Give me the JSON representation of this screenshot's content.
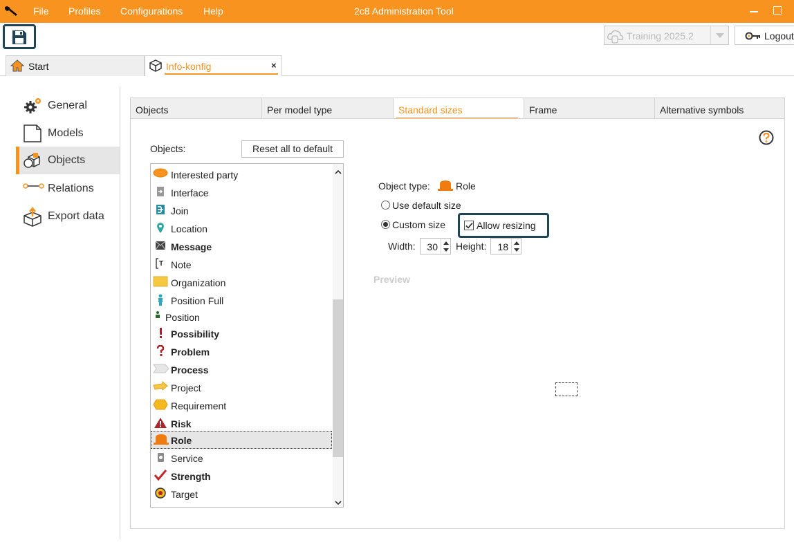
{
  "titlebar": {
    "menu": [
      "File",
      "Profiles",
      "Configurations",
      "Help"
    ],
    "title": "2c8 Administration Tool"
  },
  "toolbar": {
    "repository": "Training 2025.2",
    "logout": "Logout"
  },
  "page_tabs": [
    {
      "label": "Start",
      "icon": "home-icon"
    },
    {
      "label": "Info-konfig",
      "icon": "cube-icon",
      "close": "×"
    }
  ],
  "nav": [
    {
      "label": "General",
      "icon": "gears-icon"
    },
    {
      "label": "Models",
      "icon": "page-icon"
    },
    {
      "label": "Objects",
      "icon": "objects-icon",
      "active": true
    },
    {
      "label": "Relations",
      "icon": "relation-icon"
    },
    {
      "label": "Export data",
      "icon": "export-box-icon"
    }
  ],
  "inner_tabs": [
    "Objects",
    "Per model type",
    "Standard sizes",
    "Frame",
    "Alternative symbols"
  ],
  "standard_sizes": {
    "objects_label": "Objects:",
    "reset_label": "Reset all to default",
    "list": [
      {
        "label": "Interested party",
        "bold": false,
        "icon": "ellipse-icon"
      },
      {
        "label": "Interface",
        "bold": false,
        "icon": "interface-icon"
      },
      {
        "label": "Join",
        "bold": false,
        "icon": "join-icon"
      },
      {
        "label": "Location",
        "bold": false,
        "icon": "location-pin-icon"
      },
      {
        "label": "Message",
        "bold": true,
        "icon": "envelope-icon"
      },
      {
        "label": "Note",
        "bold": false,
        "icon": "note-icon"
      },
      {
        "label": "Organization",
        "bold": false,
        "icon": "organization-icon"
      },
      {
        "label": "Position Full",
        "bold": false,
        "icon": "person-icon"
      },
      {
        "label": "Position",
        "bold": false,
        "icon": "person-small-icon"
      },
      {
        "label": "Possibility",
        "bold": true,
        "icon": "exclamation-icon"
      },
      {
        "label": "Problem",
        "bold": true,
        "icon": "question-icon"
      },
      {
        "label": "Process",
        "bold": true,
        "icon": "process-arrow-icon"
      },
      {
        "label": "Project",
        "bold": false,
        "icon": "project-arrow-icon"
      },
      {
        "label": "Requirement",
        "bold": false,
        "icon": "hexagon-icon"
      },
      {
        "label": "Risk",
        "bold": true,
        "icon": "warning-triangle-icon"
      },
      {
        "label": "Role",
        "bold": true,
        "icon": "role-icon",
        "selected": true
      },
      {
        "label": "Service",
        "bold": false,
        "icon": "service-icon"
      },
      {
        "label": "Strength",
        "bold": true,
        "icon": "checkmark-icon"
      },
      {
        "label": "Target",
        "bold": false,
        "icon": "target-icon"
      }
    ],
    "object_type_label": "Object type:",
    "object_type_value": "Role",
    "use_default_label": "Use default size",
    "custom_size_label": "Custom size",
    "size_mode": "custom",
    "allow_resizing_label": "Allow resizing",
    "allow_resizing": true,
    "width_label": "Width:",
    "width_value": "30",
    "height_label": "Height:",
    "height_value": "18",
    "preview_label": "Preview"
  },
  "colors": {
    "accent": "#f7931e",
    "highlight_border": "#1e4455"
  }
}
